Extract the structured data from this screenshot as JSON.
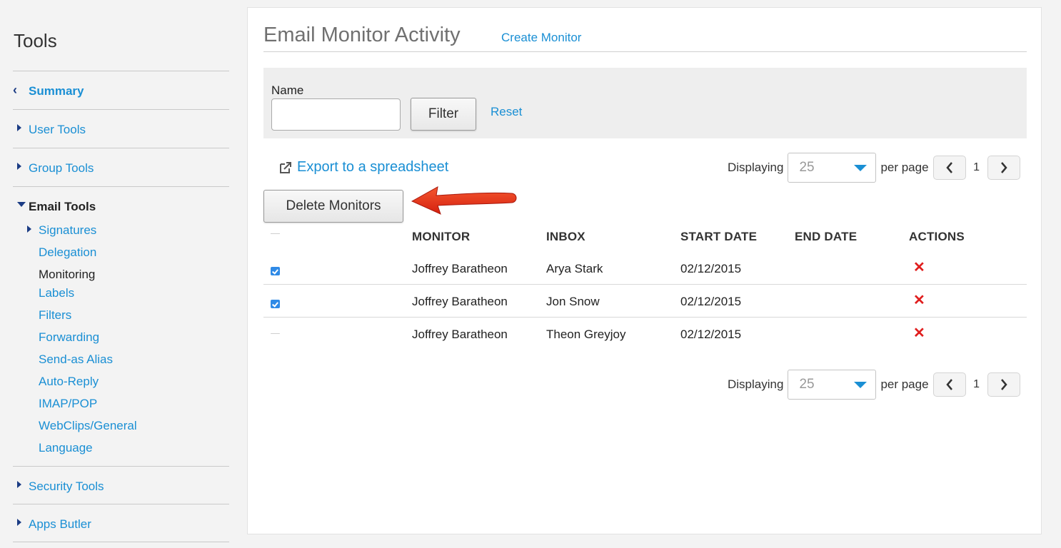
{
  "sidebar": {
    "title": "Tools",
    "summary": "Summary",
    "user_tools": "User Tools",
    "group_tools": "Group Tools",
    "email_tools": "Email Tools",
    "email_sub": [
      "Signatures",
      "Delegation",
      "Monitoring",
      "Labels",
      "Filters",
      "Forwarding",
      "Send-as Alias",
      "Auto-Reply",
      "IMAP/POP",
      "WebClips/General",
      "Language"
    ],
    "security_tools": "Security Tools",
    "apps_butler": "Apps Butler"
  },
  "main": {
    "title": "Email Monitor Activity",
    "create_link": "Create Monitor",
    "filter": {
      "label": "Name",
      "value": "",
      "button": "Filter",
      "reset": "Reset"
    },
    "export": "Export to a spreadsheet",
    "pager": {
      "displaying": "Displaying",
      "per_page_value": "25",
      "per_page": "per page",
      "page": "1"
    },
    "delete_button": "Delete Monitors",
    "table": {
      "headers": [
        "MONITOR",
        "INBOX",
        "START DATE",
        "END DATE",
        "ACTIONS"
      ],
      "rows": [
        {
          "checked": true,
          "monitor": "Joffrey Baratheon",
          "inbox": "Arya Stark",
          "start": "02/12/2015",
          "end": ""
        },
        {
          "checked": true,
          "monitor": "Joffrey Baratheon",
          "inbox": "Jon Snow",
          "start": "02/12/2015",
          "end": ""
        },
        {
          "checked": false,
          "monitor": "Joffrey Baratheon",
          "inbox": "Theon Greyjoy",
          "start": "02/12/2015",
          "end": ""
        }
      ]
    }
  },
  "colors": {
    "link": "#1a8fd4",
    "caret": "#1b3c84",
    "delete_icon": "#e01e1e",
    "arrow": "#e8321f"
  },
  "icons": {
    "back": "chevron-left-icon",
    "expand": "caret-right-icon",
    "collapse": "caret-down-icon",
    "export": "external-link-icon",
    "remove": "x-icon",
    "dropdown": "triangle-down-icon"
  }
}
